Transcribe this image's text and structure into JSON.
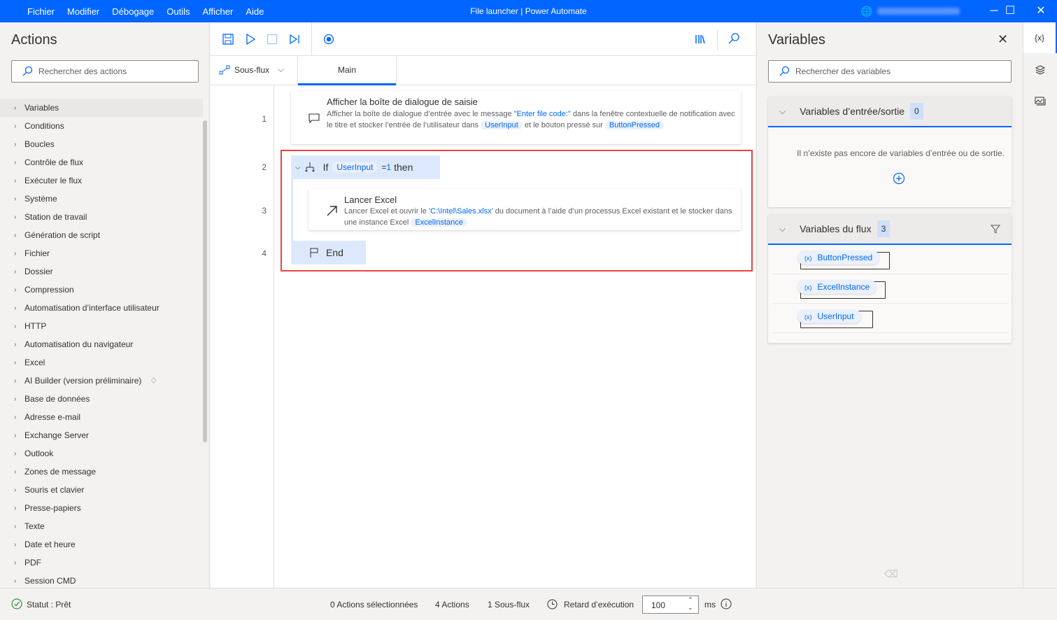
{
  "titlebar": {
    "menu": [
      "Fichier",
      "Modifier",
      "Débogage",
      "Outils",
      "Afficher",
      "Aide"
    ],
    "title": "File launcher | Power Automate",
    "accent": "#0066ff"
  },
  "actions_panel": {
    "title": "Actions",
    "search_placeholder": "Rechercher des actions",
    "items": [
      "Variables",
      "Conditions",
      "Boucles",
      "Contrôle de flux",
      "Exécuter le flux",
      "Système",
      "Station de travail",
      "Génération de script",
      "Fichier",
      "Dossier",
      "Compression",
      "Automatisation d’interface utilisateur",
      "HTTP",
      "Automatisation du navigateur",
      "Excel",
      "AI Builder (version préliminaire)",
      "Base de données",
      "Adresse e-mail",
      "Exchange Server",
      "Outlook",
      "Zones de message",
      "Souris et clavier",
      "Presse-papiers",
      "Texte",
      "Date et heure",
      "PDF",
      "Session CMD"
    ]
  },
  "designer": {
    "subflows_label": "Sous-flux",
    "tab_main": "Main",
    "steps": [
      {
        "line": "1",
        "title": "Afficher la boîte de dialogue de saisie",
        "d1": "Afficher la boîte de dialogue d’entrée avec le message ",
        "lit": "\"Enter file code:\"",
        "d2": " dans la fenêtre contextuelle de notification avec le titre  et stocker l’entrée de l’utilisateur dans ",
        "var1": "UserInput",
        "d3": " et le bouton pressé sur ",
        "var2": "ButtonPressed"
      },
      {
        "line": "2",
        "kw_if": "If",
        "var": "UserInput",
        "op": "=",
        "val": "1",
        "kw_then": "then"
      },
      {
        "line": "3",
        "title": "Lancer Excel",
        "d1": "Lancer Excel et ouvrir le ",
        "lit": "'C:\\Intel\\Sales.xlsx'",
        "d2": " du document à l’aide d’un processus Excel existant et le stocker dans une instance Excel ",
        "var": "ExcelInstance"
      },
      {
        "line": "4",
        "kw_end": "End"
      }
    ],
    "selection_color": "#e8443f"
  },
  "variables_panel": {
    "title": "Variables",
    "search_placeholder": "Rechercher des variables",
    "io": {
      "title": "Variables d’entrée/sortie",
      "count": "0",
      "empty": "Il n’existe pas encore de variables d’entrée ou de sortie."
    },
    "flow": {
      "title": "Variables du flux",
      "count": "3",
      "items": [
        "ButtonPressed",
        "ExcelInstance",
        "UserInput"
      ]
    },
    "var_prefix": "(x)"
  },
  "strip": {
    "vars_label": "{x}"
  },
  "status": {
    "status": "Statut : Prêt",
    "selected": "0 Actions sélectionnées",
    "actions": "4 Actions",
    "subflows": "1 Sous-flux",
    "delay_label": "Retard d’exécution",
    "delay_value": "100",
    "unit": "ms"
  }
}
